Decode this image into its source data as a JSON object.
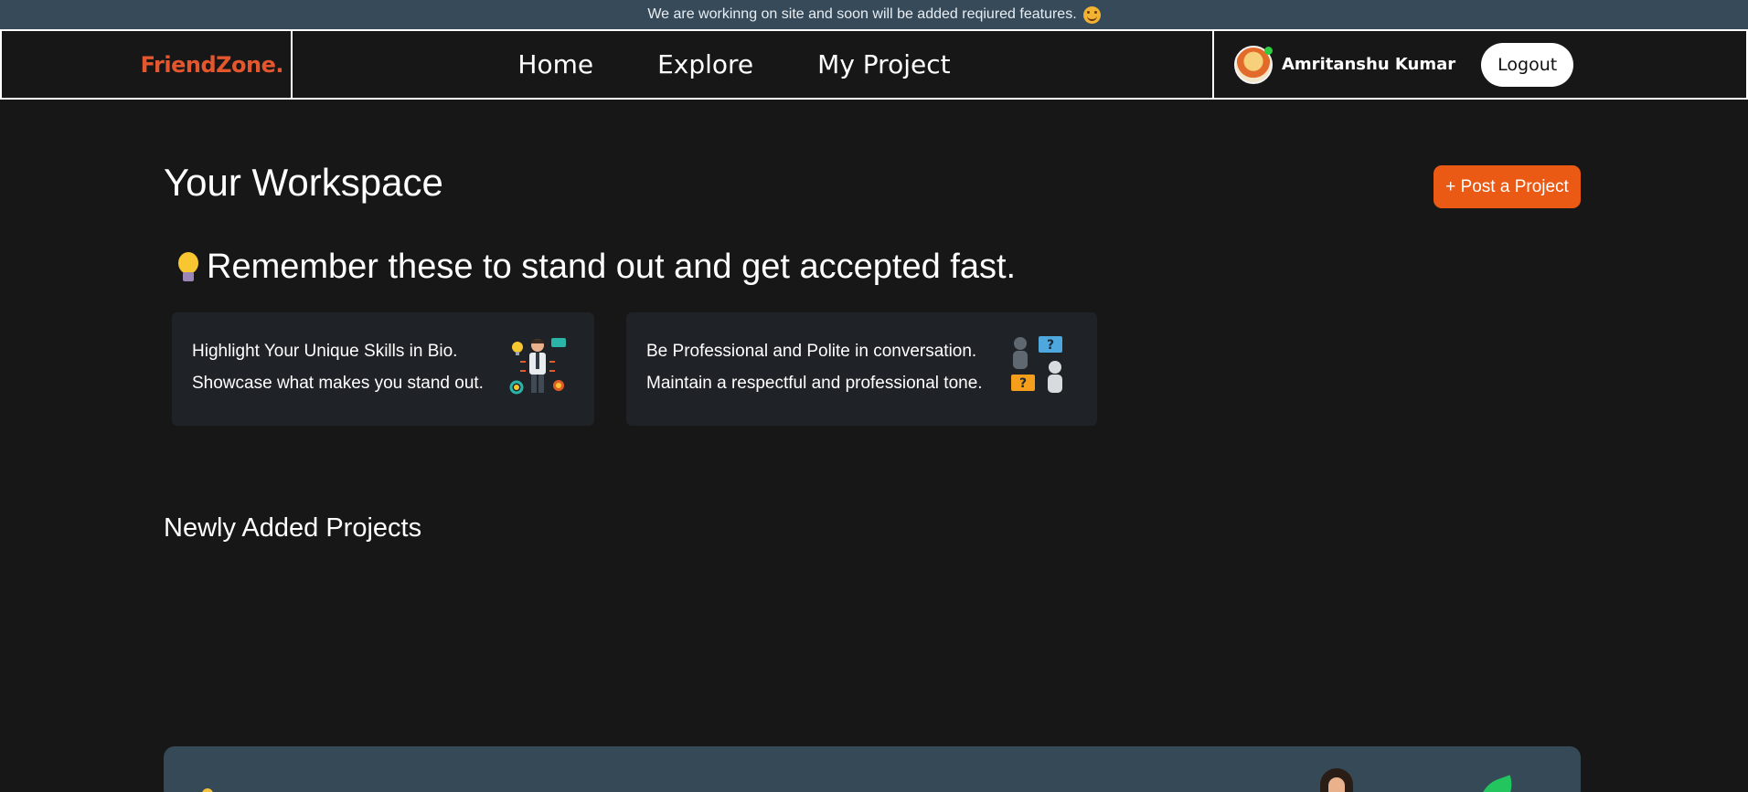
{
  "announcement": {
    "text": "We are workinng on site and soon will be added reqiured features.",
    "emoji_icon": "smiling-face-icon"
  },
  "navbar": {
    "brand": "FriendZone.",
    "links": [
      {
        "label": "Home"
      },
      {
        "label": "Explore"
      },
      {
        "label": "My Project"
      }
    ],
    "user": {
      "name": "Amritanshu Kumar",
      "avatar_icon": "avatar",
      "online": true
    },
    "logout_label": "Logout"
  },
  "workspace": {
    "title": "Your Workspace",
    "post_button": "+ Post a Project"
  },
  "tips": {
    "heading": "Remember these to stand out and get accepted fast.",
    "heading_icon": "light-bulb-icon",
    "cards": [
      {
        "line1": "Highlight Your Unique Skills in Bio.",
        "line2": "Showcase what makes you stand out.",
        "illustration": "skills-person-icon"
      },
      {
        "line1": "Be Professional and Polite in conversation.",
        "line2": "Maintain a respectful and professional tone.",
        "illustration": "conversation-people-icon"
      }
    ]
  },
  "projects_section": {
    "title": "Newly Added Projects"
  },
  "colors": {
    "background": "#171717",
    "announcement_bar": "#374a59",
    "brand": "#e4572e",
    "accent_button": "#ea5a14",
    "card": "#1f2226",
    "banner": "#364957"
  }
}
